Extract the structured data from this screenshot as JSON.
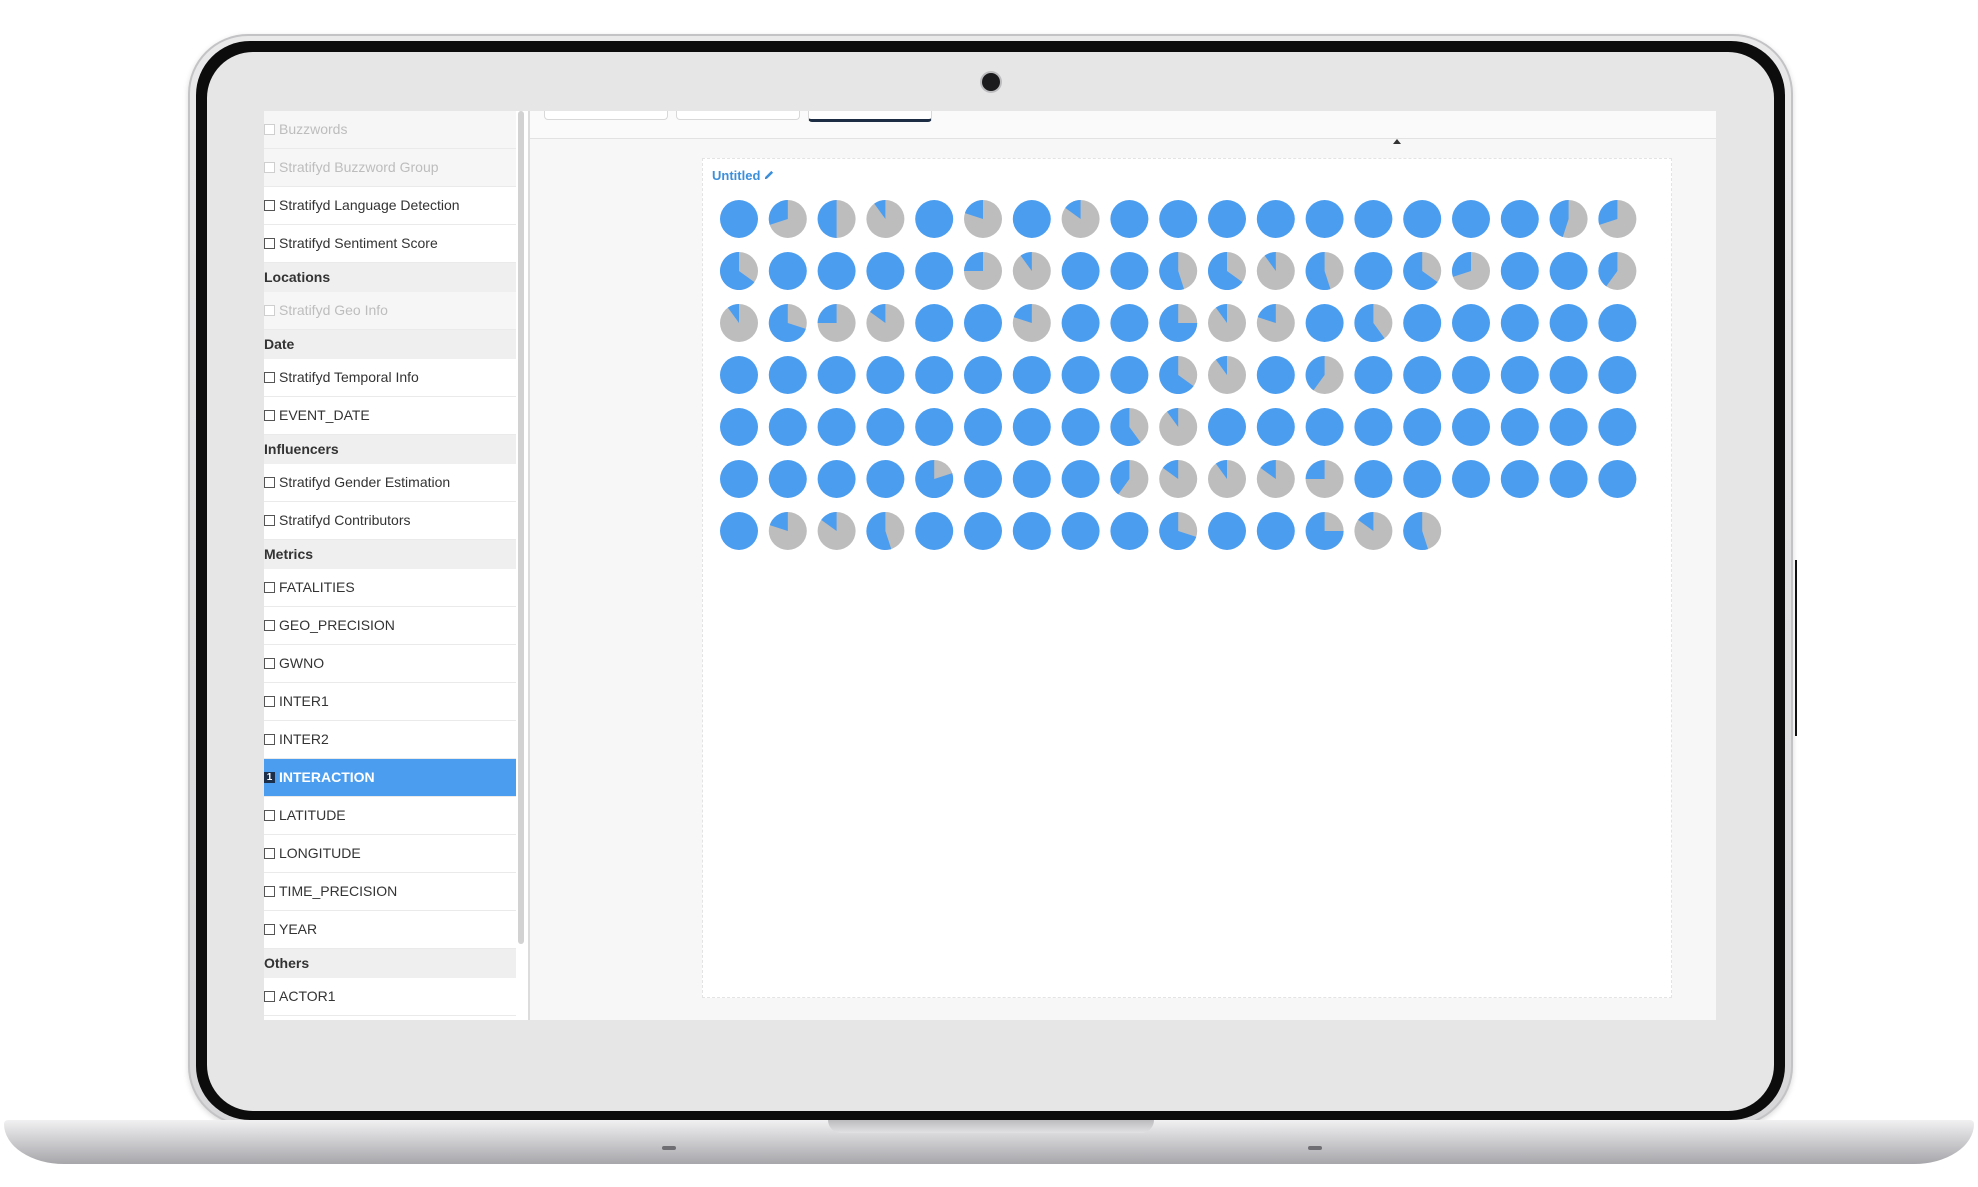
{
  "sidebar": {
    "items": [
      {
        "type": "item",
        "label": "Buzzwords",
        "state": "disabled"
      },
      {
        "type": "item",
        "label": "Stratifyd Buzzword Group",
        "state": "disabled"
      },
      {
        "type": "item",
        "label": "Stratifyd Language Detection",
        "state": "normal"
      },
      {
        "type": "item",
        "label": "Stratifyd Sentiment Score",
        "state": "normal"
      },
      {
        "type": "group",
        "label": "Locations"
      },
      {
        "type": "item",
        "label": "Stratifyd Geo Info",
        "state": "disabled"
      },
      {
        "type": "group",
        "label": "Date"
      },
      {
        "type": "item",
        "label": "Stratifyd Temporal Info",
        "state": "normal"
      },
      {
        "type": "item",
        "label": "EVENT_DATE",
        "state": "normal"
      },
      {
        "type": "group",
        "label": "Influencers"
      },
      {
        "type": "item",
        "label": "Stratifyd Gender Estimation",
        "state": "normal"
      },
      {
        "type": "item",
        "label": "Stratifyd Contributors",
        "state": "normal"
      },
      {
        "type": "group",
        "label": "Metrics"
      },
      {
        "type": "item",
        "label": "FATALITIES",
        "state": "normal"
      },
      {
        "type": "item",
        "label": "GEO_PRECISION",
        "state": "normal"
      },
      {
        "type": "item",
        "label": "GWNO",
        "state": "normal"
      },
      {
        "type": "item",
        "label": "INTER1",
        "state": "normal"
      },
      {
        "type": "item",
        "label": "INTER2",
        "state": "normal"
      },
      {
        "type": "item",
        "label": "INTERACTION",
        "state": "selected",
        "badge": "1"
      },
      {
        "type": "item",
        "label": "LATITUDE",
        "state": "normal"
      },
      {
        "type": "item",
        "label": "LONGITUDE",
        "state": "normal"
      },
      {
        "type": "item",
        "label": "TIME_PRECISION",
        "state": "normal"
      },
      {
        "type": "item",
        "label": "YEAR",
        "state": "normal"
      },
      {
        "type": "group",
        "label": "Others"
      },
      {
        "type": "item",
        "label": "ACTOR1",
        "state": "normal"
      }
    ]
  },
  "widget": {
    "title": "Untitled",
    "edit_icon": "pencil-icon"
  },
  "colors": {
    "accent_blue": "#4b9df0",
    "secondary_gray": "#bdbdbd",
    "selected_row": "#4b9df0"
  },
  "chart_data": {
    "type": "pie-grid",
    "series": [
      {
        "name": "",
        "color": "#4b9df0"
      },
      {
        "name": "",
        "color": "#bdbdbd"
      }
    ],
    "columns": 19,
    "blue_fraction": [
      1,
      0.3,
      0.5,
      0.1,
      1,
      0.2,
      1,
      0.15,
      1,
      1,
      1,
      1,
      1,
      1,
      1,
      1,
      1,
      0.45,
      0.3,
      0.65,
      1,
      1,
      1,
      1,
      0.25,
      0.1,
      1,
      1,
      0.55,
      0.65,
      0.1,
      0.55,
      1,
      0.65,
      0.3,
      1,
      1,
      0.4,
      0.1,
      0.7,
      0.25,
      0.15,
      1,
      1,
      0.2,
      1,
      1,
      0.75,
      0.1,
      0.2,
      1,
      0.6,
      1,
      1,
      1,
      1,
      1,
      1,
      1,
      1,
      1,
      1,
      1,
      1,
      1,
      1,
      0.65,
      0.1,
      1,
      0.4,
      1,
      1,
      1,
      1,
      1,
      1,
      1,
      1,
      1,
      1,
      1,
      1,
      1,
      1,
      0.6,
      0.1,
      1,
      1,
      1,
      1,
      1,
      1,
      1,
      1,
      1,
      1,
      1,
      1,
      1,
      0.8,
      1,
      1,
      1,
      0.4,
      0.15,
      0.1,
      0.15,
      0.25,
      1,
      1,
      1,
      1,
      1,
      1,
      1,
      0.2,
      0.15,
      0.55,
      1,
      1,
      1,
      1,
      1,
      0.7,
      1,
      1,
      0.75,
      0.15,
      0.55
    ]
  }
}
